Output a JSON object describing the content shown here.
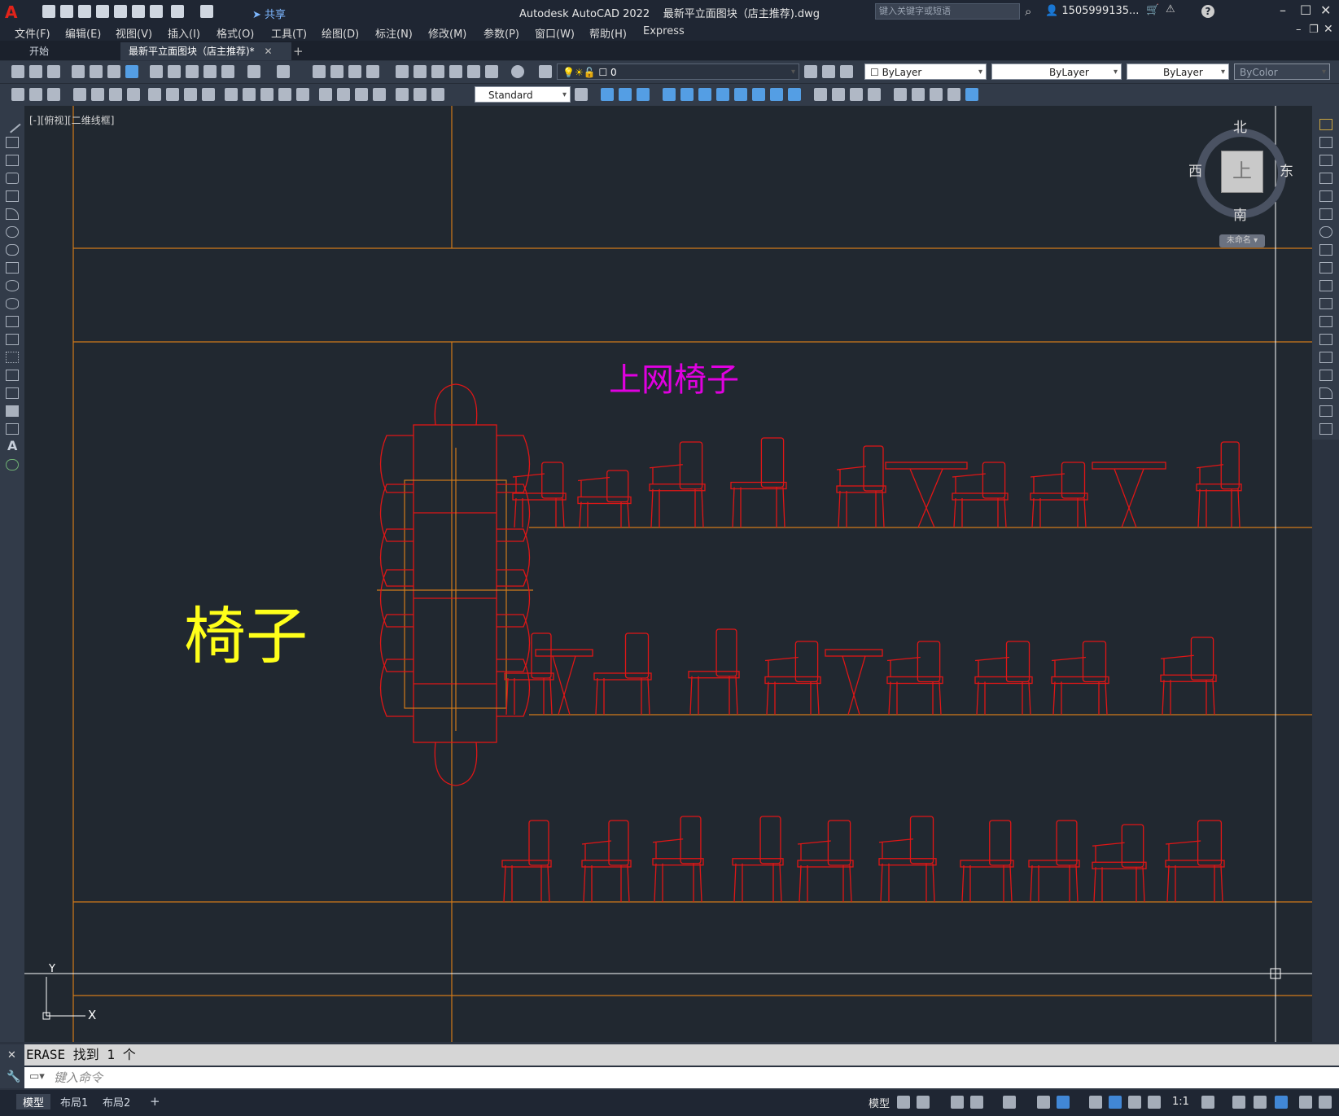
{
  "app": {
    "title": "Autodesk AutoCAD 2022",
    "file": "最新平立面图块（店主推荐).dwg",
    "logo": "A",
    "share_label": "共享",
    "search_placeholder": "键入关键字或短语",
    "user": "1505999135...",
    "help": "?"
  },
  "menu": [
    "文件(F)",
    "编辑(E)",
    "视图(V)",
    "插入(I)",
    "格式(O)",
    "工具(T)",
    "绘图(D)",
    "标注(N)",
    "修改(M)",
    "参数(P)",
    "窗口(W)",
    "帮助(H)",
    "Express"
  ],
  "tabs": {
    "start": "开始",
    "active": "最新平立面图块（店主推荐)*",
    "close": "✕",
    "new": "+"
  },
  "toolbar": {
    "layer_value": "0",
    "color": "ByLayer",
    "linetype": "ByLayer",
    "lineweight": "ByLayer",
    "plotstyle": "ByColor",
    "text_style": "Standard"
  },
  "viewport": {
    "label": "[-][俯视][二维线框]"
  },
  "viewcube": {
    "north": "北",
    "south": "南",
    "east": "东",
    "west": "西",
    "top": "上",
    "ucs": "未命名"
  },
  "drawing": {
    "title_magenta": "上网椅子",
    "title_yellow": "椅子",
    "ucs_y": "Y",
    "ucs_x": "X"
  },
  "colors": {
    "canvas": "#212830",
    "orange_line": "#d17a1a",
    "red_chair": "#e01616",
    "magenta_text": "#e000e0",
    "yellow_text": "#ffff1a"
  },
  "command": {
    "history": "ERASE 找到 1 个",
    "placeholder": "键入命令"
  },
  "layouts": [
    "模型",
    "布局1",
    "布局2"
  ],
  "layout_add": "+",
  "status": {
    "model": "模型",
    "scale": "1:1"
  }
}
